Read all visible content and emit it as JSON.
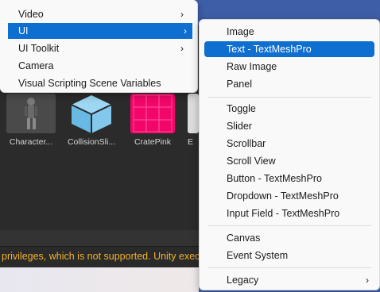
{
  "main_menu": {
    "items": [
      {
        "label": "Video",
        "submenu": true
      },
      {
        "label": "UI",
        "submenu": true,
        "highlighted": true
      },
      {
        "label": "UI Toolkit",
        "submenu": true
      },
      {
        "label": "Camera",
        "submenu": false
      },
      {
        "label": "Visual Scripting Scene Variables",
        "submenu": false
      }
    ],
    "arrow_glyph": "›"
  },
  "sub_menu": {
    "items": [
      {
        "label": "Image"
      },
      {
        "label": "Text - TextMeshPro",
        "highlighted": true
      },
      {
        "label": "Raw Image"
      },
      {
        "label": "Panel"
      },
      {
        "label": "Toggle"
      },
      {
        "label": "Slider"
      },
      {
        "label": "Scrollbar"
      },
      {
        "label": "Scroll View"
      },
      {
        "label": "Button - TextMeshPro"
      },
      {
        "label": "Dropdown - TextMeshPro"
      },
      {
        "label": "Input Field - TextMeshPro"
      },
      {
        "label": "Canvas"
      },
      {
        "label": "Event System"
      },
      {
        "label": "Legacy",
        "submenu": true
      }
    ]
  },
  "assets": [
    {
      "label": "Character...",
      "icon": "character-prefab-icon"
    },
    {
      "label": "CollisionSli...",
      "icon": "cube-icon"
    },
    {
      "label": "CratePink",
      "icon": "pink-crate-icon"
    },
    {
      "label": "E",
      "icon": "prefab-icon"
    }
  ],
  "console": {
    "message": "privileges, which is not supported. Unity exec"
  },
  "colors": {
    "highlight": "#0f6fd0",
    "menu_bg": "#f9f9f9",
    "warning_text": "#f1b22c",
    "crate_pink": "#f2066a",
    "cube_blue": "#7cc8ee"
  }
}
